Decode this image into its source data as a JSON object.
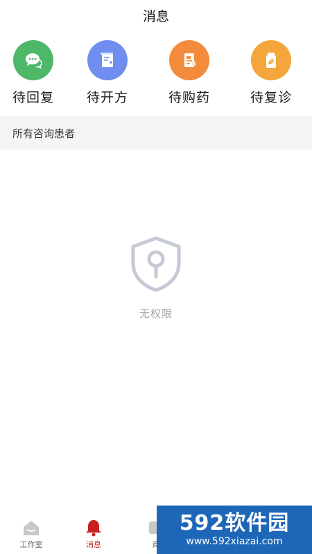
{
  "header": {
    "title": "消息"
  },
  "quick_actions": [
    {
      "label": "待回复",
      "icon": "chat-bubble-icon",
      "color": "#4cb868"
    },
    {
      "label": "待开方",
      "icon": "prescription-icon",
      "color": "#6f8ef0"
    },
    {
      "label": "待购药",
      "icon": "order-document-icon",
      "color": "#f28b3c"
    },
    {
      "label": "待复诊",
      "icon": "medicine-bottle-icon",
      "color": "#f4a53c"
    }
  ],
  "section": {
    "label": "所有咨询患者"
  },
  "empty_state": {
    "icon": "shield-lock-icon",
    "text": "无权限"
  },
  "tabbar": {
    "items": [
      {
        "label": "工作室",
        "icon": "home-icon",
        "active": false
      },
      {
        "label": "消息",
        "icon": "bell-icon",
        "active": true,
        "color": "#c8201e"
      },
      {
        "label": "商",
        "icon": "phone-icon",
        "active": false
      }
    ]
  },
  "watermark": {
    "main": "592软件园",
    "sub": "www.592xiazai.com"
  }
}
